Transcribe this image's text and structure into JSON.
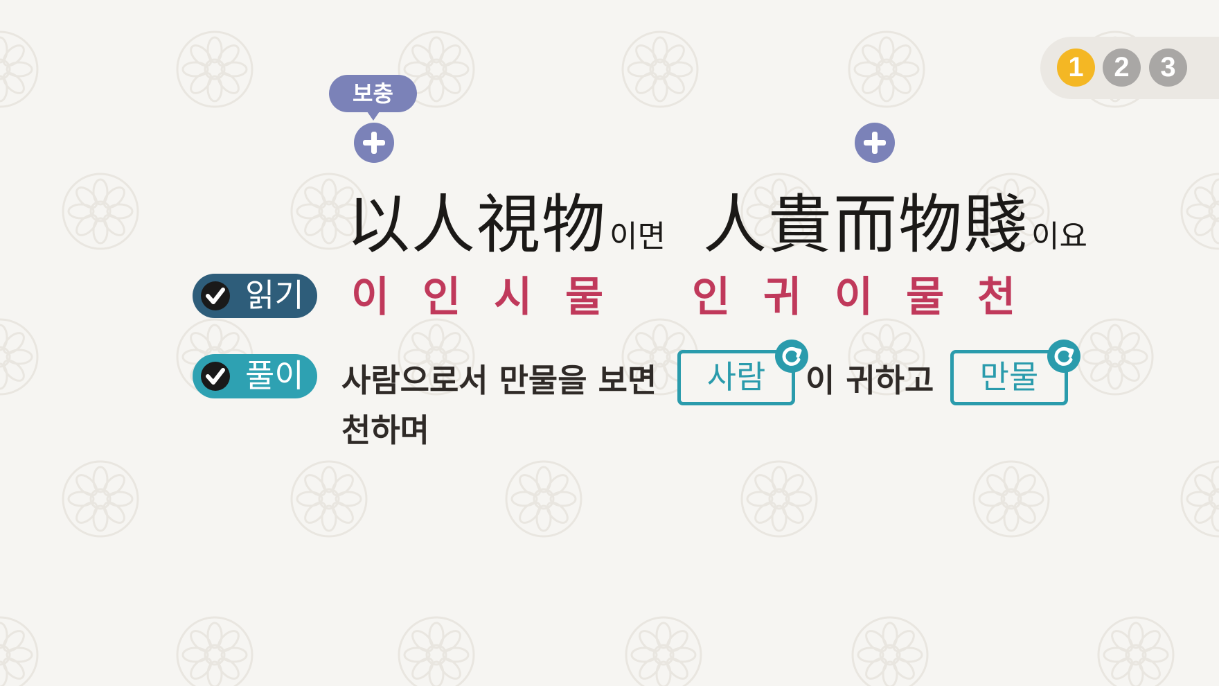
{
  "pager": {
    "pages": [
      "1",
      "2",
      "3"
    ],
    "active_page": "1"
  },
  "supplement": {
    "label": "보충"
  },
  "hanja": {
    "part1": "以人視物",
    "suffix1": "이면",
    "part2": "人貴而物賤",
    "suffix2": "이요"
  },
  "reading": {
    "label": "읽기",
    "syllables_1": [
      "이",
      "인",
      "시",
      "물"
    ],
    "syllables_2": [
      "인",
      "귀",
      "이",
      "물",
      "천"
    ]
  },
  "explanation": {
    "label": "풀이",
    "text_1": "사람으로서 만물을 보면",
    "blank_1": "사람",
    "text_2": "이 귀하고",
    "blank_2": "만물",
    "text_3": "천하며"
  },
  "colors": {
    "accent_yellow": "#f4b724",
    "reading_red": "#c0395b",
    "teal": "#2a9bac",
    "navy": "#2e5d7a",
    "purple": "#7b82b8"
  },
  "icons": [
    "plus-icon",
    "check-icon",
    "refresh-icon"
  ]
}
